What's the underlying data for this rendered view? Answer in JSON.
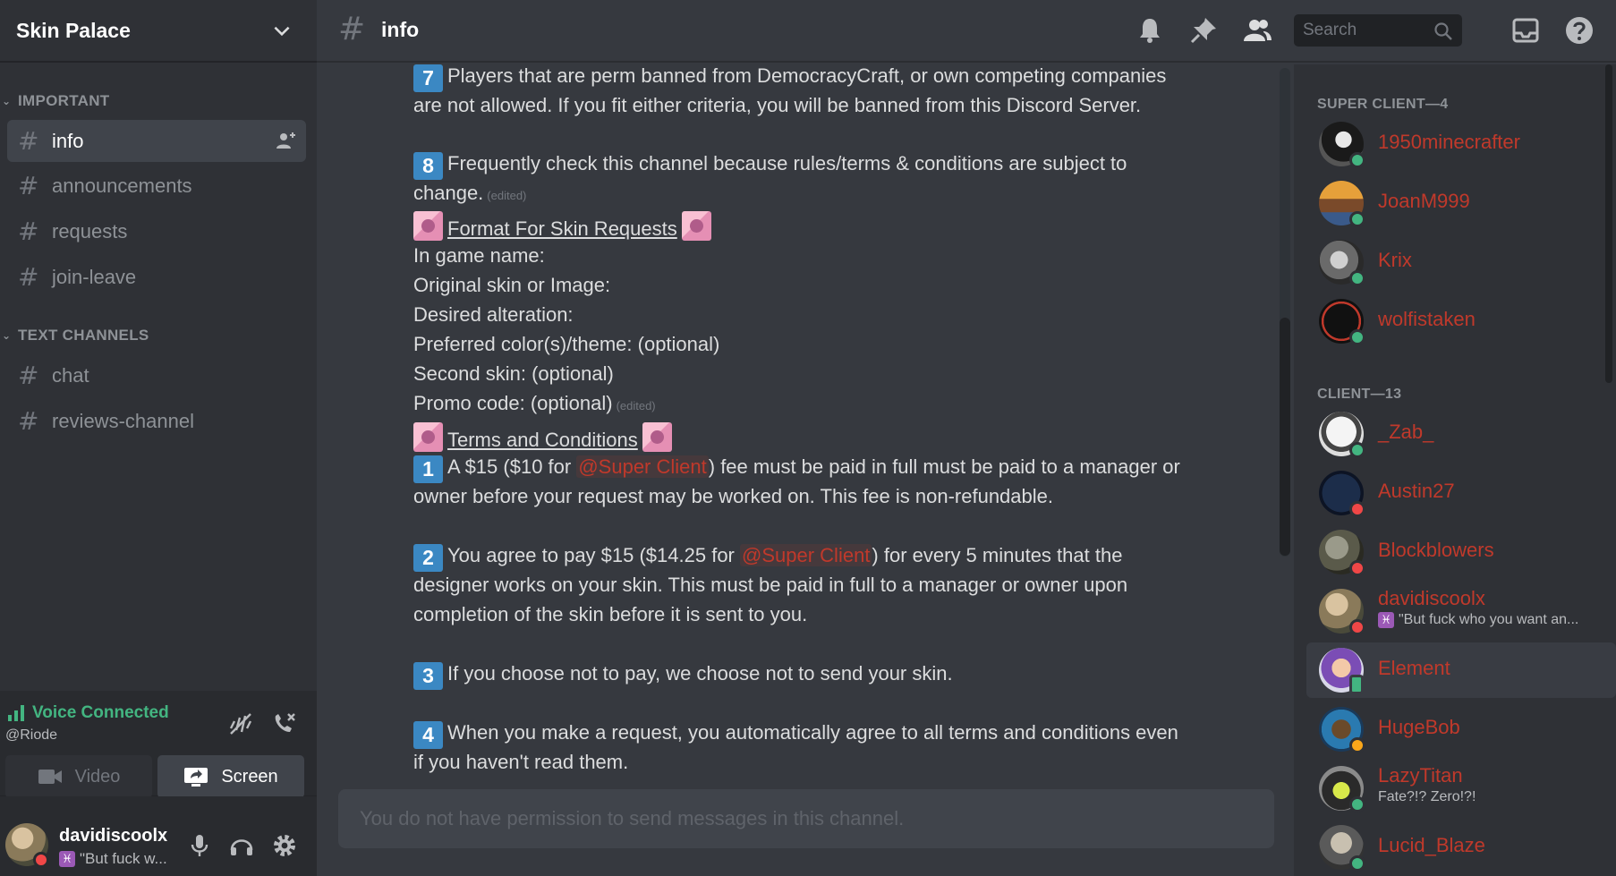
{
  "server": {
    "name": "Skin Palace"
  },
  "sidebar": {
    "categories": [
      {
        "label": "IMPORTANT"
      },
      {
        "label": "TEXT CHANNELS"
      }
    ],
    "channels": [
      {
        "label": "info"
      },
      {
        "label": "announcements"
      },
      {
        "label": "requests"
      },
      {
        "label": "join-leave"
      },
      {
        "label": "chat"
      },
      {
        "label": "reviews-channel"
      }
    ]
  },
  "voice": {
    "status": "Voice Connected",
    "channel": "@Riode",
    "video_label": "Video",
    "screen_label": "Screen"
  },
  "user": {
    "name": "davidiscoolx",
    "custom_status": "\"But fuck w..."
  },
  "topbar": {
    "channel": "info",
    "search_placeholder": "Search"
  },
  "messages": {
    "rule7_line1": "Players that are perm banned from DemocracyCraft, or own competing companies",
    "rule7_line2": "are not allowed. If you fit either criteria, you will be banned from this Discord Server.",
    "rule8_line1": "Frequently check this channel because rules/terms & conditions are subject to",
    "rule8_line2": "change.",
    "edited": "(edited)",
    "format_title": "Format For Skin Requests",
    "format_fields": [
      "In game name:",
      "Original skin or Image:",
      "Desired alteration:",
      "Preferred color(s)/theme: (optional)",
      "Second skin: (optional)",
      "Promo code: (optional)"
    ],
    "terms_title": "Terms and Conditions",
    "mention": "@Super Client",
    "t1_pre": "A $15 ($10 for",
    "t1_post": ") fee must be paid in full must be paid to a manager or",
    "t1_line2": "owner before your request may be worked on. This fee is non-refundable.",
    "t2_pre": "You agree to pay $15 ($14.25 for",
    "t2_post": ") for every 5 minutes that the",
    "t2_line2": "designer works on your skin. This must be paid in full to a manager or owner upon",
    "t2_line3": "completion of the skin before it is sent to you.",
    "t3": "If you choose not to pay, we choose not to send your skin.",
    "t4_line1": "When you make a request, you automatically agree to all terms and conditions even",
    "t4_line2": "if you haven't read them.",
    "numbers": [
      "7",
      "8",
      "1",
      "2",
      "3",
      "4"
    ]
  },
  "input": {
    "placeholder": "You do not have permission to send messages in this channel."
  },
  "member_list": {
    "super_header": "SUPER CLIENT—4",
    "client_header": "CLIENT—13",
    "super_clients": [
      "1950minecrafter",
      "JoanM999",
      "Krix",
      "wolfistaken"
    ],
    "clients": [
      "_Zab_",
      "Austin27",
      "Blockblowers",
      "davidiscoolx",
      "Element",
      "HugeBob",
      "LazyTitan",
      "Lucid_Blaze"
    ],
    "statuses": {
      "davidiscoolx": "\"But fuck who you want an...",
      "LazyTitan": "Fate?!? Zero!?!"
    }
  },
  "colors": {
    "role": "#c0392b",
    "online": "#43b581",
    "dnd": "#f04747",
    "idle": "#faa61a",
    "number_badge": "#3b88c3"
  }
}
